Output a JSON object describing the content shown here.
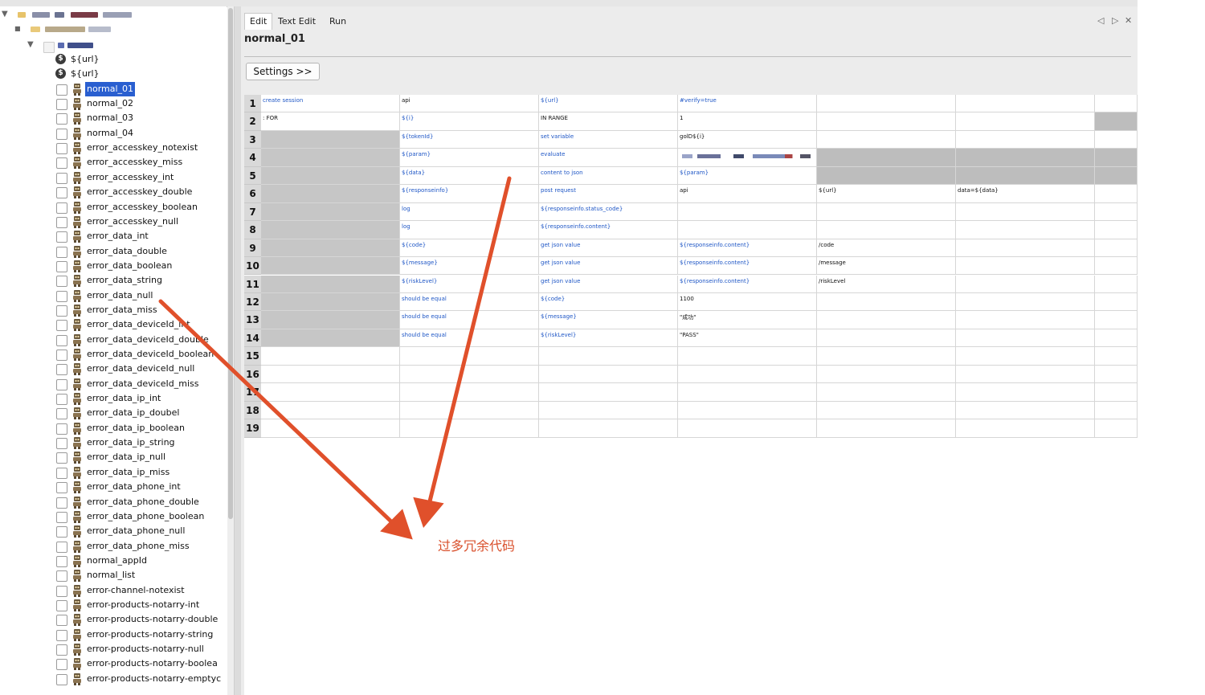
{
  "tree": {
    "items": [
      {
        "label": "${url}",
        "icon": "dollar-icon"
      },
      {
        "label": "${url}",
        "icon": "dollar-icon"
      },
      {
        "label": "normal_01",
        "icon": "robot-icon",
        "selected": true
      },
      {
        "label": "normal_02",
        "icon": "robot-icon"
      },
      {
        "label": "normal_03",
        "icon": "robot-icon"
      },
      {
        "label": "normal_04",
        "icon": "robot-icon"
      },
      {
        "label": "error_accesskey_notexist",
        "icon": "robot-icon"
      },
      {
        "label": "error_accesskey_miss",
        "icon": "robot-icon"
      },
      {
        "label": "error_accesskey_int",
        "icon": "robot-icon"
      },
      {
        "label": "error_accesskey_double",
        "icon": "robot-icon"
      },
      {
        "label": "error_accesskey_boolean",
        "icon": "robot-icon"
      },
      {
        "label": "error_accesskey_null",
        "icon": "robot-icon"
      },
      {
        "label": "error_data_int",
        "icon": "robot-icon"
      },
      {
        "label": "error_data_double",
        "icon": "robot-icon"
      },
      {
        "label": "error_data_boolean",
        "icon": "robot-icon"
      },
      {
        "label": "error_data_string",
        "icon": "robot-icon"
      },
      {
        "label": "error_data_null",
        "icon": "robot-icon"
      },
      {
        "label": "error_data_miss",
        "icon": "robot-icon"
      },
      {
        "label": "error_data_deviceId_int",
        "icon": "robot-icon"
      },
      {
        "label": "error_data_deviceId_double",
        "icon": "robot-icon"
      },
      {
        "label": "error_data_deviceId_boolean",
        "icon": "robot-icon"
      },
      {
        "label": "error_data_deviceId_null",
        "icon": "robot-icon"
      },
      {
        "label": "error_data_deviceId_miss",
        "icon": "robot-icon"
      },
      {
        "label": "error_data_ip_int",
        "icon": "robot-icon"
      },
      {
        "label": "error_data_ip_doubel",
        "icon": "robot-icon"
      },
      {
        "label": "error_data_ip_boolean",
        "icon": "robot-icon"
      },
      {
        "label": "error_data_ip_string",
        "icon": "robot-icon"
      },
      {
        "label": "error_data_ip_null",
        "icon": "robot-icon"
      },
      {
        "label": "error_data_ip_miss",
        "icon": "robot-icon"
      },
      {
        "label": "error_data_phone_int",
        "icon": "robot-icon"
      },
      {
        "label": "error_data_phone_double",
        "icon": "robot-icon"
      },
      {
        "label": "error_data_phone_boolean",
        "icon": "robot-icon"
      },
      {
        "label": "error_data_phone_null",
        "icon": "robot-icon"
      },
      {
        "label": "error_data_phone_miss",
        "icon": "robot-icon"
      },
      {
        "label": "normal_appId",
        "icon": "robot-icon"
      },
      {
        "label": "normal_list",
        "icon": "robot-icon"
      },
      {
        "label": "error-channel-notexist",
        "icon": "robot-icon"
      },
      {
        "label": "error-products-notarry-int",
        "icon": "robot-icon"
      },
      {
        "label": "error-products-notarry-double",
        "icon": "robot-icon"
      },
      {
        "label": "error-products-notarry-string",
        "icon": "robot-icon"
      },
      {
        "label": "error-products-notarry-null",
        "icon": "robot-icon"
      },
      {
        "label": "error-products-notarry-boolea",
        "icon": "robot-icon"
      },
      {
        "label": "error-products-notarry-emptyc",
        "icon": "robot-icon"
      }
    ]
  },
  "tabs": {
    "edit": "Edit",
    "text_edit": "Text Edit",
    "run": "Run"
  },
  "tab_controls": {
    "prev": "◁",
    "next": "▷",
    "close": "✕"
  },
  "editor": {
    "title": "normal_01",
    "settings_label": "Settings >>"
  },
  "grid": {
    "row_numbers": [
      "1",
      "2",
      "3",
      "4",
      "5",
      "6",
      "7",
      "8",
      "9",
      "10",
      "11",
      "12",
      "13",
      "14",
      "15",
      "16",
      "17",
      "18",
      "19"
    ],
    "rows": [
      [
        "create session",
        "api",
        "${url}",
        "#verify=true",
        "",
        ""
      ],
      [
        ": FOR",
        "${i}",
        "IN RANGE",
        "1",
        "",
        ""
      ],
      [
        "",
        "${tokenId}",
        "set variable",
        "golD${i}",
        "",
        ""
      ],
      [
        "",
        "${param}",
        "evaluate",
        "",
        "",
        ""
      ],
      [
        "",
        "${data}",
        "content to json",
        "${param}",
        "",
        ""
      ],
      [
        "",
        "${responseinfo}",
        "post request",
        "api",
        "${url}",
        "data=${data}"
      ],
      [
        "",
        "log",
        "${responseinfo.status_code}",
        "",
        "",
        ""
      ],
      [
        "",
        "log",
        "${responseinfo.content}",
        "",
        "",
        ""
      ],
      [
        "",
        "${code}",
        "get json value",
        "${responseinfo.content}",
        "/code",
        ""
      ],
      [
        "",
        "${message}",
        "get json value",
        "${responseinfo.content}",
        "/message",
        ""
      ],
      [
        "",
        "${riskLevel}",
        "get json value",
        "${responseinfo.content}",
        "/riskLevel",
        ""
      ],
      [
        "",
        "should be equal",
        "${code}",
        "1100",
        "",
        ""
      ],
      [
        "",
        "should be equal",
        "${message}",
        "\"成功\"",
        "",
        ""
      ],
      [
        "",
        "should be equal",
        "${riskLevel}",
        "\"PASS\"",
        "",
        ""
      ],
      [
        "",
        "",
        "",
        "",
        "",
        ""
      ],
      [
        "",
        "",
        "",
        "",
        "",
        ""
      ],
      [
        "",
        "",
        "",
        "",
        "",
        ""
      ],
      [
        "",
        "",
        "",
        "",
        "",
        ""
      ],
      [
        "",
        "",
        "",
        "",
        "",
        ""
      ]
    ]
  },
  "annotation": {
    "text": "过多冗余代码",
    "color": "#d9502c"
  }
}
